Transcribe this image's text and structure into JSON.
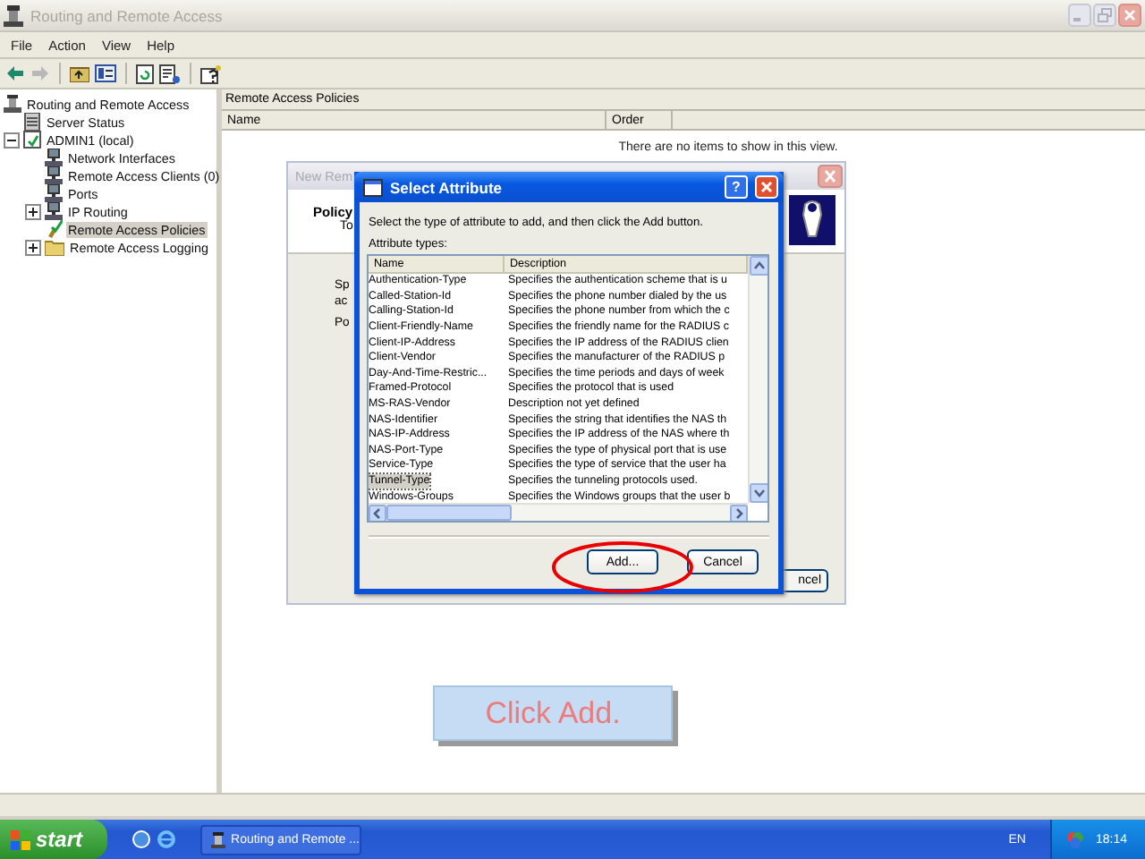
{
  "window": {
    "title": "Routing and Remote Access"
  },
  "menu": [
    "File",
    "Action",
    "View",
    "Help"
  ],
  "tree": {
    "items": [
      {
        "label": "Routing and Remote Access",
        "selected": false,
        "children": [
          {
            "label": "Server Status",
            "selected": false
          },
          {
            "label": "ADMIN1 (local)",
            "selected": false,
            "expanded": true,
            "children": [
              {
                "label": "Network Interfaces",
                "selected": false
              },
              {
                "label": "Remote Access Clients (0)",
                "selected": false
              },
              {
                "label": "Ports",
                "selected": false
              },
              {
                "label": "IP Routing",
                "selected": false,
                "expanded": false
              },
              {
                "label": "Remote Access Policies",
                "selected": true
              },
              {
                "label": "Remote Access Logging",
                "selected": false,
                "expanded": false
              }
            ]
          }
        ]
      }
    ]
  },
  "list_pane": {
    "title": "Remote Access Policies",
    "columns": [
      "Name",
      "Order"
    ],
    "empty_message": "There are no items to show in this view."
  },
  "background_dialog": {
    "title": "New Rem",
    "texts": [
      "Policy",
      "To",
      "Sp",
      "ac",
      "Po"
    ],
    "button": "ncel"
  },
  "select_attribute": {
    "title": "Select Attribute",
    "help_button": "?",
    "instruction": "Select the type of attribute to add, and then click the Add button.",
    "list_label": "Attribute types:",
    "columns": [
      "Name",
      "Description"
    ],
    "rows": [
      {
        "name": "Authentication-Type",
        "description": "Specifies the authentication scheme that is u",
        "selected": false
      },
      {
        "name": "Called-Station-Id",
        "description": "Specifies the phone number dialed by the us",
        "selected": false
      },
      {
        "name": "Calling-Station-Id",
        "description": "Specifies the phone number from which the c",
        "selected": false
      },
      {
        "name": "Client-Friendly-Name",
        "description": "Specifies the friendly name for the RADIUS c",
        "selected": false
      },
      {
        "name": "Client-IP-Address",
        "description": "Specifies the IP address of the RADIUS clien",
        "selected": false
      },
      {
        "name": "Client-Vendor",
        "description": "Specifies the manufacturer of the RADIUS p",
        "selected": false
      },
      {
        "name": "Day-And-Time-Restric...",
        "description": "Specifies the time periods and days of week",
        "selected": false
      },
      {
        "name": "Framed-Protocol",
        "description": "Specifies the protocol that is used",
        "selected": false
      },
      {
        "name": "MS-RAS-Vendor",
        "description": "Description not yet defined",
        "selected": false
      },
      {
        "name": "NAS-Identifier",
        "description": "Specifies the string that identifies the NAS th",
        "selected": false
      },
      {
        "name": "NAS-IP-Address",
        "description": "Specifies the IP address of the NAS where th",
        "selected": false
      },
      {
        "name": "NAS-Port-Type",
        "description": "Specifies the type of physical port that is use",
        "selected": false
      },
      {
        "name": "Service-Type",
        "description": "Specifies the type of service that the user ha",
        "selected": false
      },
      {
        "name": "Tunnel-Type",
        "description": "Specifies the tunneling protocols used.",
        "selected": true
      },
      {
        "name": "Windows-Groups",
        "description": "Specifies the Windows groups that the user b",
        "selected": false
      }
    ],
    "buttons": [
      "Add...",
      "Cancel"
    ]
  },
  "caption": "Click Add.",
  "taskbar": {
    "start": "start",
    "tasks": [
      "Routing and Remote ..."
    ],
    "language": "EN",
    "clock": "18:14"
  }
}
